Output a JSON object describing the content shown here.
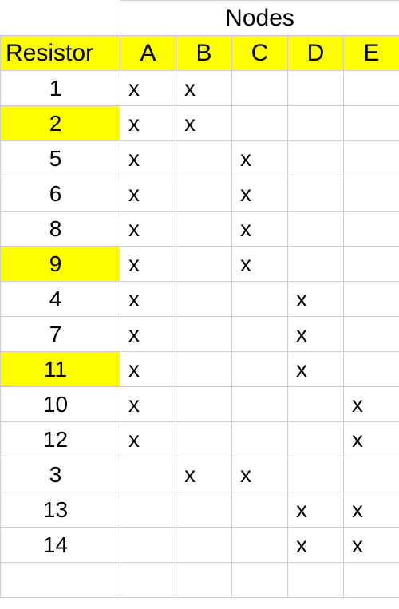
{
  "headers": {
    "nodes_group": "Nodes",
    "resistor": "Resistor",
    "nodes": [
      "A",
      "B",
      "C",
      "D",
      "E"
    ]
  },
  "mark": "x",
  "rows": [
    {
      "resistor": "1",
      "hl": false,
      "nodes": [
        "x",
        "x",
        "",
        "",
        ""
      ]
    },
    {
      "resistor": "2",
      "hl": true,
      "nodes": [
        "x",
        "x",
        "",
        "",
        ""
      ]
    },
    {
      "resistor": "5",
      "hl": false,
      "nodes": [
        "x",
        "",
        "x",
        "",
        ""
      ]
    },
    {
      "resistor": "6",
      "hl": false,
      "nodes": [
        "x",
        "",
        "x",
        "",
        ""
      ]
    },
    {
      "resistor": "8",
      "hl": false,
      "nodes": [
        "x",
        "",
        "x",
        "",
        ""
      ]
    },
    {
      "resistor": "9",
      "hl": true,
      "nodes": [
        "x",
        "",
        "x",
        "",
        ""
      ]
    },
    {
      "resistor": "4",
      "hl": false,
      "nodes": [
        "x",
        "",
        "",
        "x",
        ""
      ]
    },
    {
      "resistor": "7",
      "hl": false,
      "nodes": [
        "x",
        "",
        "",
        "x",
        ""
      ]
    },
    {
      "resistor": "11",
      "hl": true,
      "nodes": [
        "x",
        "",
        "",
        "x",
        ""
      ]
    },
    {
      "resistor": "10",
      "hl": false,
      "nodes": [
        "x",
        "",
        "",
        "",
        "x"
      ]
    },
    {
      "resistor": "12",
      "hl": false,
      "nodes": [
        "x",
        "",
        "",
        "",
        "x"
      ]
    },
    {
      "resistor": "3",
      "hl": false,
      "nodes": [
        "",
        "x",
        "x",
        "",
        ""
      ]
    },
    {
      "resistor": "13",
      "hl": false,
      "nodes": [
        "",
        "",
        "",
        "x",
        "x"
      ]
    },
    {
      "resistor": "14",
      "hl": false,
      "nodes": [
        "",
        "",
        "",
        "x",
        "x"
      ]
    }
  ]
}
